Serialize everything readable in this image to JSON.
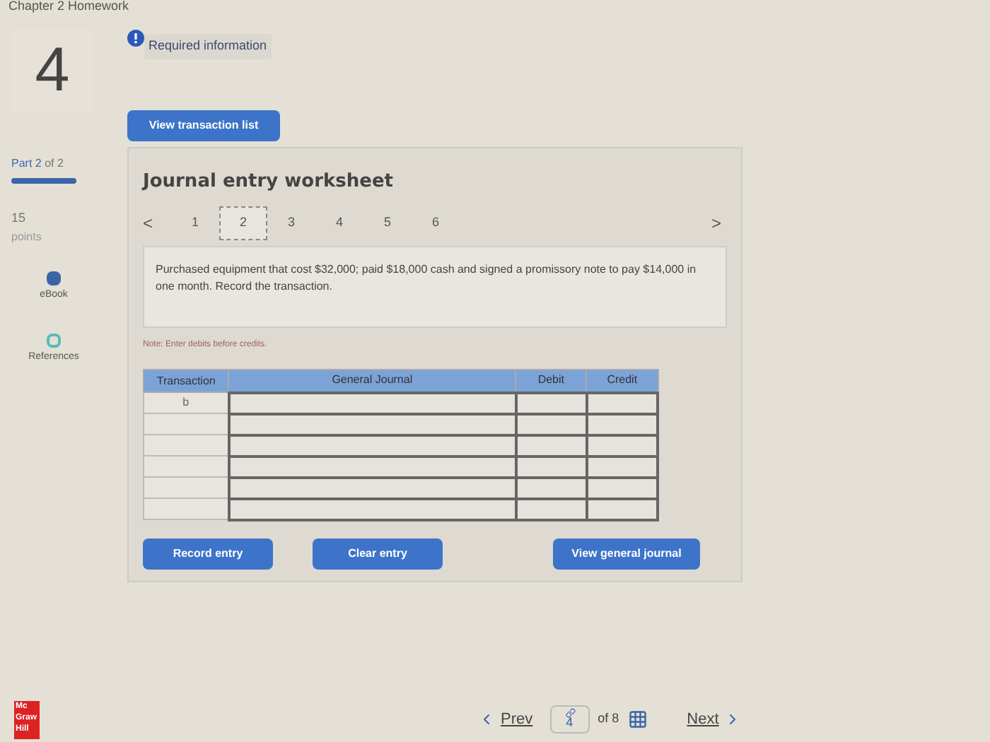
{
  "header": {
    "title": "Chapter 2 Homework"
  },
  "sidebar": {
    "question_number": "4",
    "part": {
      "label": "Part",
      "current": "2",
      "total_text": "of 2",
      "level": 1
    },
    "points": {
      "value": "15",
      "label": "points"
    },
    "links": [
      {
        "kind": "ebook",
        "label": "eBook"
      },
      {
        "kind": "references",
        "label": "References"
      }
    ]
  },
  "required_info": {
    "label": "Required information"
  },
  "view_transaction_button": "View transaction list",
  "worksheet": {
    "title": "Journal entry worksheet",
    "prev": "<",
    "next": ">",
    "steps": [
      {
        "label": "1",
        "selected": false
      },
      {
        "label": "2",
        "selected": true
      },
      {
        "label": "3",
        "selected": false
      },
      {
        "label": "4",
        "selected": false
      },
      {
        "label": "5",
        "selected": false
      },
      {
        "label": "6",
        "selected": false
      }
    ],
    "prompt": "Purchased equipment that cost $32,000; paid $18,000 cash and signed a promissory note to pay $14,000 in one month. Record the transaction.",
    "note": "Note: Enter debits before credits.",
    "table": {
      "columns": [
        "Transaction",
        "General Journal",
        "Debit",
        "Credit"
      ],
      "rows": [
        {
          "transaction": "b"
        },
        {},
        {},
        {},
        {},
        {}
      ]
    },
    "buttons": [
      "Record entry",
      "Clear entry",
      "View general journal"
    ]
  },
  "footer": {
    "logo": [
      "Mc",
      "Graw",
      "Hill"
    ],
    "prev": "Prev",
    "page": "4",
    "of": "of 8",
    "next": "Next"
  }
}
